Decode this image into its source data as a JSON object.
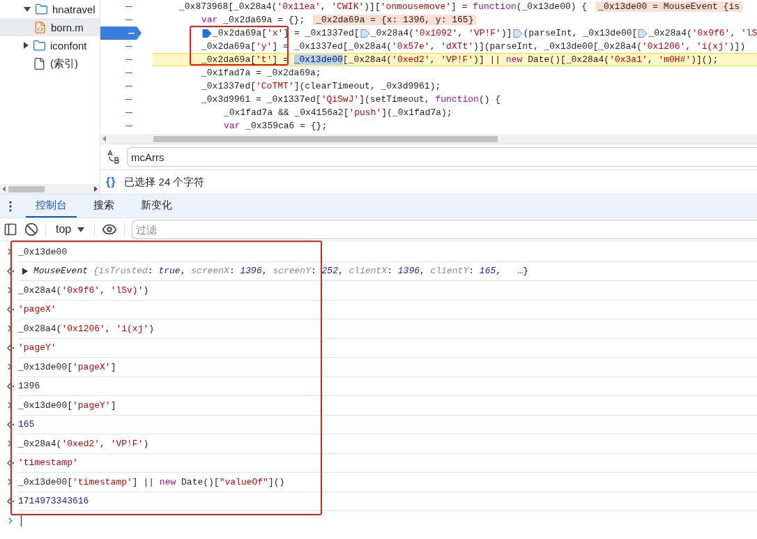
{
  "file_tree": {
    "items": [
      {
        "label": "hnatravel",
        "kind": "folder",
        "expanded": true,
        "selected": false,
        "children": [
          {
            "label": "born.m",
            "kind": "script",
            "selected": true
          }
        ]
      },
      {
        "label": "iconfont",
        "kind": "folder",
        "expanded": false,
        "selected": false
      },
      {
        "label": "(索引)",
        "kind": "document",
        "selected": false
      }
    ]
  },
  "code": {
    "lines": [
      {
        "breakpoint": false,
        "current": false,
        "tokens": [
          {
            "kind": "plain",
            "text": "_0x873968[_0x28a4("
          },
          {
            "kind": "string",
            "text": "'0x11ea'"
          },
          {
            "kind": "plain",
            "text": ", "
          },
          {
            "kind": "string",
            "text": "'CWIK'"
          },
          {
            "kind": "plain",
            "text": ")]["
          },
          {
            "kind": "string",
            "text": "'onmousemove'"
          },
          {
            "kind": "plain",
            "text": "] = "
          },
          {
            "kind": "keyword",
            "text": "function"
          },
          {
            "kind": "plain",
            "text": "(_0x13de00) {"
          },
          {
            "kind": "inline_value",
            "text": "_0x13de00 = MouseEvent {is"
          }
        ],
        "children": [
          {
            "breakpoint": false,
            "current": false,
            "tokens": [
              {
                "kind": "keyword",
                "text": "var"
              },
              {
                "kind": "plain",
                "text": " _0x2da69a = {};"
              },
              {
                "kind": "inline_value",
                "text": "_0x2da69a = {x: 1396, y: 165}"
              }
            ]
          },
          {
            "breakpoint": true,
            "current": false,
            "tokens": [
              {
                "kind": "breakpoint",
                "active": true
              },
              {
                "kind": "plain",
                "text": "_0x2da69a["
              },
              {
                "kind": "string",
                "text": "'x'"
              },
              {
                "kind": "plain",
                "text": "] = _0x1337ed["
              },
              {
                "kind": "breakpoint",
                "active": false
              },
              {
                "kind": "plain",
                "text": "_0x28a4("
              },
              {
                "kind": "string",
                "text": "'0x1092'"
              },
              {
                "kind": "plain",
                "text": ", "
              },
              {
                "kind": "string",
                "text": "'VP!F'"
              },
              {
                "kind": "plain",
                "text": ")]"
              },
              {
                "kind": "breakpoint",
                "active": false
              },
              {
                "kind": "plain",
                "text": "(parseInt, _0x13de00["
              },
              {
                "kind": "breakpoint",
                "active": false
              },
              {
                "kind": "plain",
                "text": "_0x28a4("
              },
              {
                "kind": "string",
                "text": "'0x9f6'"
              },
              {
                "kind": "plain",
                "text": ", "
              },
              {
                "kind": "string",
                "text": "'lS"
              }
            ]
          },
          {
            "breakpoint": false,
            "current": false,
            "tokens": [
              {
                "kind": "plain",
                "text": "_0x2da69a["
              },
              {
                "kind": "string",
                "text": "'y'"
              },
              {
                "kind": "plain",
                "text": "] = _0x1337ed[_0x28a4("
              },
              {
                "kind": "string",
                "text": "'0x57e'"
              },
              {
                "kind": "plain",
                "text": ", "
              },
              {
                "kind": "string",
                "text": "'dXTt'"
              },
              {
                "kind": "plain",
                "text": ")](parseInt, _0x13de00[_0x28a4("
              },
              {
                "kind": "string",
                "text": "'0x1206'"
              },
              {
                "kind": "plain",
                "text": ", "
              },
              {
                "kind": "string",
                "text": "'i(xj'"
              },
              {
                "kind": "plain",
                "text": ")])"
              }
            ]
          },
          {
            "breakpoint": false,
            "current": true,
            "tokens": [
              {
                "kind": "plain",
                "text": "_0x2da69a["
              },
              {
                "kind": "string",
                "text": "'t'"
              },
              {
                "kind": "plain",
                "text": "] = "
              },
              {
                "kind": "selection",
                "text": "_0x13de00"
              },
              {
                "kind": "plain",
                "text": "[_0x28a4("
              },
              {
                "kind": "string",
                "text": "'0xed2'"
              },
              {
                "kind": "plain",
                "text": ", "
              },
              {
                "kind": "string",
                "text": "'VP!F'"
              },
              {
                "kind": "plain",
                "text": ")] || "
              },
              {
                "kind": "keyword",
                "text": "new"
              },
              {
                "kind": "plain",
                "text": " Date()[_0x28a4("
              },
              {
                "kind": "string",
                "text": "'0x3a1'"
              },
              {
                "kind": "plain",
                "text": ", "
              },
              {
                "kind": "string",
                "text": "'m0H#'"
              },
              {
                "kind": "plain",
                "text": ")]();"
              }
            ]
          },
          {
            "breakpoint": false,
            "current": false,
            "tokens": [
              {
                "kind": "plain",
                "text": "_0x1fad7a = _0x2da69a;"
              }
            ]
          },
          {
            "breakpoint": false,
            "current": false,
            "tokens": [
              {
                "kind": "plain",
                "text": "_0x1337ed["
              },
              {
                "kind": "string",
                "text": "'CoTMT'"
              },
              {
                "kind": "plain",
                "text": "](clearTimeout, _0x3d9961);"
              }
            ]
          },
          {
            "breakpoint": false,
            "current": false,
            "tokens": [
              {
                "kind": "plain",
                "text": "_0x3d9961 = _0x1337ed["
              },
              {
                "kind": "string",
                "text": "'QiSwJ'"
              },
              {
                "kind": "plain",
                "text": "](setTimeout, "
              },
              {
                "kind": "keyword",
                "text": "function"
              },
              {
                "kind": "plain",
                "text": "() {"
              }
            ],
            "children": [
              {
                "breakpoint": false,
                "current": false,
                "tokens": [
                  {
                    "kind": "plain",
                    "text": "_0x1fad7a && _0x4156a2["
                  },
                  {
                    "kind": "string",
                    "text": "'push'"
                  },
                  {
                    "kind": "plain",
                    "text": "](_0x1fad7a);"
                  }
                ]
              },
              {
                "breakpoint": false,
                "current": false,
                "tokens": [
                  {
                    "kind": "keyword",
                    "text": "var"
                  },
                  {
                    "kind": "plain",
                    "text": " _0x359ca6 = {};"
                  }
                ]
              }
            ]
          }
        ]
      }
    ]
  },
  "search": {
    "value": "mcArrs"
  },
  "status": {
    "icon": "{}",
    "text": "已选择 24 个字符"
  },
  "drawer_tabs": [
    {
      "label": "控制台",
      "selected": true
    },
    {
      "label": "搜索",
      "selected": false
    },
    {
      "label": "新变化",
      "selected": false
    }
  ],
  "toolbar": {
    "context": "top",
    "filter_placeholder": "过滤"
  },
  "console": [
    {
      "kind": "input",
      "tokens": [
        {
          "kind": "plain",
          "text": "_0x13de00"
        }
      ]
    },
    {
      "kind": "object",
      "tokens": [
        {
          "kind": "preview_type",
          "text": "MouseEvent"
        },
        {
          "kind": "preview_key",
          "text": " {isTrusted"
        },
        {
          "kind": "plain",
          "text": ": "
        },
        {
          "kind": "preview_value",
          "text": "true"
        },
        {
          "kind": "plain",
          "text": ", "
        },
        {
          "kind": "preview_key",
          "text": "screenX"
        },
        {
          "kind": "plain",
          "text": ": "
        },
        {
          "kind": "preview_value",
          "text": "1396"
        },
        {
          "kind": "plain",
          "text": ", "
        },
        {
          "kind": "preview_key",
          "text": "screenY"
        },
        {
          "kind": "plain",
          "text": ": "
        },
        {
          "kind": "preview_value",
          "text": "252"
        },
        {
          "kind": "plain",
          "text": ", "
        },
        {
          "kind": "preview_key",
          "text": "clientX"
        },
        {
          "kind": "plain",
          "text": ": "
        },
        {
          "kind": "preview_value",
          "text": "1396"
        },
        {
          "kind": "plain",
          "text": ", "
        },
        {
          "kind": "preview_key",
          "text": "clientY"
        },
        {
          "kind": "plain",
          "text": ": "
        },
        {
          "kind": "preview_value",
          "text": "165"
        },
        {
          "kind": "plain",
          "text": ",   …}"
        }
      ]
    },
    {
      "kind": "input",
      "tokens": [
        {
          "kind": "plain",
          "text": "_0x28a4("
        },
        {
          "kind": "string",
          "text": "'0x9f6'"
        },
        {
          "kind": "plain",
          "text": ", "
        },
        {
          "kind": "string",
          "text": "'lSv)'"
        },
        {
          "kind": "plain",
          "text": ")"
        }
      ]
    },
    {
      "kind": "output",
      "tokens": [
        {
          "kind": "string",
          "text": "'pageX'"
        }
      ]
    },
    {
      "kind": "input",
      "tokens": [
        {
          "kind": "plain",
          "text": "_0x28a4("
        },
        {
          "kind": "string",
          "text": "'0x1206'"
        },
        {
          "kind": "plain",
          "text": ", "
        },
        {
          "kind": "string",
          "text": "'i(xj'"
        },
        {
          "kind": "plain",
          "text": ")"
        }
      ]
    },
    {
      "kind": "output",
      "tokens": [
        {
          "kind": "string",
          "text": "'pageY'"
        }
      ]
    },
    {
      "kind": "input",
      "tokens": [
        {
          "kind": "plain",
          "text": "_0x13de00["
        },
        {
          "kind": "string",
          "text": "'pageX'"
        },
        {
          "kind": "plain",
          "text": "]"
        }
      ]
    },
    {
      "kind": "output",
      "tokens": [
        {
          "kind": "number",
          "text": "1396"
        }
      ]
    },
    {
      "kind": "input",
      "tokens": [
        {
          "kind": "plain",
          "text": "_0x13de00["
        },
        {
          "kind": "string",
          "text": "'pageY'"
        },
        {
          "kind": "plain",
          "text": "]"
        }
      ]
    },
    {
      "kind": "output",
      "tokens": [
        {
          "kind": "number",
          "text": "165"
        }
      ]
    },
    {
      "kind": "input",
      "tokens": [
        {
          "kind": "plain",
          "text": "_0x28a4("
        },
        {
          "kind": "string",
          "text": "'0xed2'"
        },
        {
          "kind": "plain",
          "text": ", "
        },
        {
          "kind": "string",
          "text": "'VP!F'"
        },
        {
          "kind": "plain",
          "text": ")"
        }
      ]
    },
    {
      "kind": "output",
      "tokens": [
        {
          "kind": "string",
          "text": "'timestamp'"
        }
      ]
    },
    {
      "kind": "input",
      "tokens": [
        {
          "kind": "plain",
          "text": "_0x13de00["
        },
        {
          "kind": "string",
          "text": "'timestamp'"
        },
        {
          "kind": "plain",
          "text": "] || "
        },
        {
          "kind": "keyword",
          "text": "new"
        },
        {
          "kind": "plain",
          "text": " Date()["
        },
        {
          "kind": "string",
          "text": "\"valueOf\""
        },
        {
          "kind": "plain",
          "text": "]()"
        }
      ]
    },
    {
      "kind": "output",
      "tokens": [
        {
          "kind": "number",
          "text": "1714973343616"
        }
      ]
    }
  ],
  "frames": {
    "code": true,
    "console": true
  }
}
